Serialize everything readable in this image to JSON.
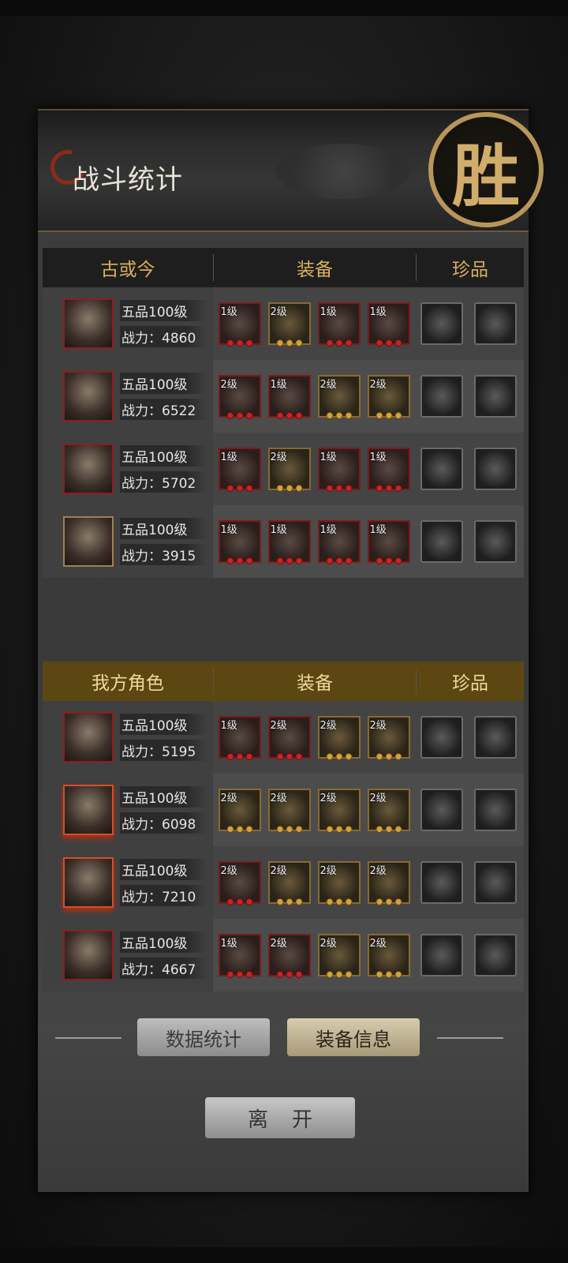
{
  "header": {
    "title": "战斗统计",
    "seal_char": "胜"
  },
  "enemy": {
    "columns": {
      "char": "古或今",
      "equip": "装备",
      "treasure": "珍品"
    },
    "rows": [
      {
        "rank": "五品100级",
        "power": "战力：4860",
        "portrait": "warrior-armored",
        "equip": [
          {
            "lv": "1级",
            "tier": "red"
          },
          {
            "lv": "2级",
            "tier": "gold"
          },
          {
            "lv": "1级",
            "tier": "red"
          },
          {
            "lv": "1级",
            "tier": "red"
          }
        ],
        "treasures": [
          "iron-box",
          "mushroom"
        ]
      },
      {
        "rank": "五品100级",
        "power": "战力：6522",
        "portrait": "girl-dark",
        "equip": [
          {
            "lv": "2级",
            "tier": "red"
          },
          {
            "lv": "1级",
            "tier": "red"
          },
          {
            "lv": "2级",
            "tier": "gold"
          },
          {
            "lv": "2级",
            "tier": "gold"
          }
        ],
        "treasures": [
          "staff",
          "hairpin"
        ]
      },
      {
        "rank": "五品100级",
        "power": "战力：5702",
        "portrait": "youth-green",
        "equip": [
          {
            "lv": "1级",
            "tier": "red"
          },
          {
            "lv": "2级",
            "tier": "gold"
          },
          {
            "lv": "1级",
            "tier": "red"
          },
          {
            "lv": "1级",
            "tier": "red"
          }
        ],
        "treasures": [
          "teapot",
          "comb"
        ]
      },
      {
        "rank": "五品100级",
        "power": "战力：3915",
        "portrait": "lady-flower",
        "equip": [
          {
            "lv": "1级",
            "tier": "red"
          },
          {
            "lv": "1级",
            "tier": "red"
          },
          {
            "lv": "1级",
            "tier": "red"
          },
          {
            "lv": "1级",
            "tier": "red"
          }
        ],
        "treasures": [
          "stone",
          "pouch"
        ]
      }
    ]
  },
  "ally": {
    "columns": {
      "char": "我方角色",
      "equip": "装备",
      "treasure": "珍品"
    },
    "rows": [
      {
        "rank": "五品100级",
        "power": "战力：5195",
        "portrait": "lady-flower",
        "equip": [
          {
            "lv": "1级",
            "tier": "red"
          },
          {
            "lv": "2级",
            "tier": "red"
          },
          {
            "lv": "2级",
            "tier": "gold"
          },
          {
            "lv": "2级",
            "tier": "gold"
          }
        ],
        "treasures": [
          "comb-gold",
          "fan"
        ]
      },
      {
        "rank": "五品100级",
        "power": "战力：6098",
        "portrait": "beast-man",
        "equip": [
          {
            "lv": "2级",
            "tier": "gold"
          },
          {
            "lv": "2级",
            "tier": "gold"
          },
          {
            "lv": "2级",
            "tier": "gold"
          },
          {
            "lv": "2级",
            "tier": "gold"
          }
        ],
        "treasures": [
          "iron-box",
          "comb"
        ]
      },
      {
        "rank": "五品100级",
        "power": "战力：7210",
        "portrait": "girl-dark",
        "equip": [
          {
            "lv": "2级",
            "tier": "red"
          },
          {
            "lv": "2级",
            "tier": "gold"
          },
          {
            "lv": "2级",
            "tier": "gold"
          },
          {
            "lv": "2级",
            "tier": "gold"
          }
        ],
        "treasures": [
          "amber",
          "ladle"
        ]
      },
      {
        "rank": "五品100级",
        "power": "战力：4667",
        "portrait": "hat-man",
        "equip": [
          {
            "lv": "1级",
            "tier": "red"
          },
          {
            "lv": "2级",
            "tier": "red"
          },
          {
            "lv": "2级",
            "tier": "gold"
          },
          {
            "lv": "2级",
            "tier": "gold"
          }
        ],
        "treasures": [
          "hairpin",
          "comb-gold"
        ]
      }
    ]
  },
  "tabs": {
    "stats": "数据统计",
    "equip": "装备信息"
  },
  "leave_label": "离开"
}
